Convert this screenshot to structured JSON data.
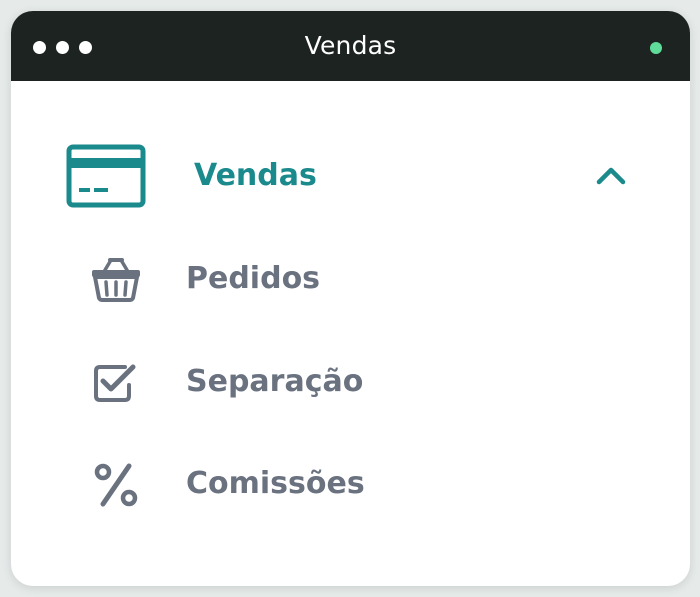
{
  "window": {
    "title": "Vendas",
    "status_color": "#5fdc9a"
  },
  "menu": {
    "header": {
      "label": "Vendas",
      "icon": "credit-card-icon",
      "expanded": true,
      "accent_color": "#1a8a8d"
    },
    "items": [
      {
        "label": "Pedidos",
        "icon": "shopping-basket-icon"
      },
      {
        "label": "Separação",
        "icon": "checkbox-checked-icon"
      },
      {
        "label": "Comissões",
        "icon": "percent-icon"
      }
    ],
    "item_color": "#6a7280"
  }
}
